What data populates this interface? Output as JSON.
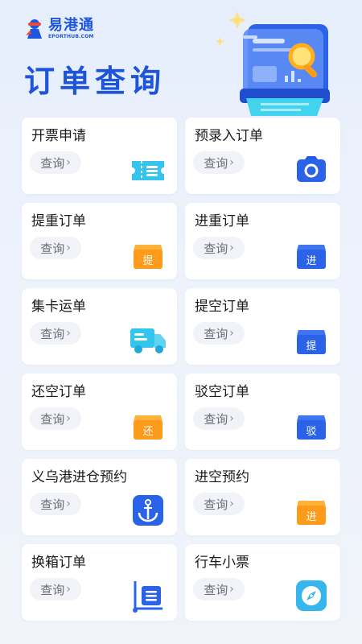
{
  "app": {
    "name": "易港通",
    "name_en": "EPORTHUB.COM"
  },
  "page": {
    "title": "订单查询"
  },
  "query_label": "查询",
  "colors": {
    "brand_blue": "#1e54d9",
    "orange": "#ff9b1a",
    "card_bg": "#ffffff"
  },
  "cards": [
    {
      "title": "开票申请",
      "action": "查询",
      "icon": "ticket-icon"
    },
    {
      "title": "预录入订单",
      "action": "查询",
      "icon": "camera-icon"
    },
    {
      "title": "提重订单",
      "action": "查询",
      "icon": "box-ti-icon",
      "badge": "提"
    },
    {
      "title": "进重订单",
      "action": "查询",
      "icon": "box-jin-icon",
      "badge": "进"
    },
    {
      "title": "集卡运单",
      "action": "查询",
      "icon": "truck-icon"
    },
    {
      "title": "提空订单",
      "action": "查询",
      "icon": "box-ti-empty-icon",
      "badge": "提"
    },
    {
      "title": "还空订单",
      "action": "查询",
      "icon": "box-huan-icon",
      "badge": "还"
    },
    {
      "title": "驳空订单",
      "action": "查询",
      "icon": "box-bo-icon",
      "badge": "驳"
    },
    {
      "title": "义乌港进仓预约",
      "action": "查询",
      "icon": "anchor-icon"
    },
    {
      "title": "进空预约",
      "action": "查询",
      "icon": "box-jin-empty-icon",
      "badge": "进"
    },
    {
      "title": "换箱订单",
      "action": "查询",
      "icon": "container-swap-icon"
    },
    {
      "title": "行车小票",
      "action": "查询",
      "icon": "compass-icon"
    }
  ]
}
